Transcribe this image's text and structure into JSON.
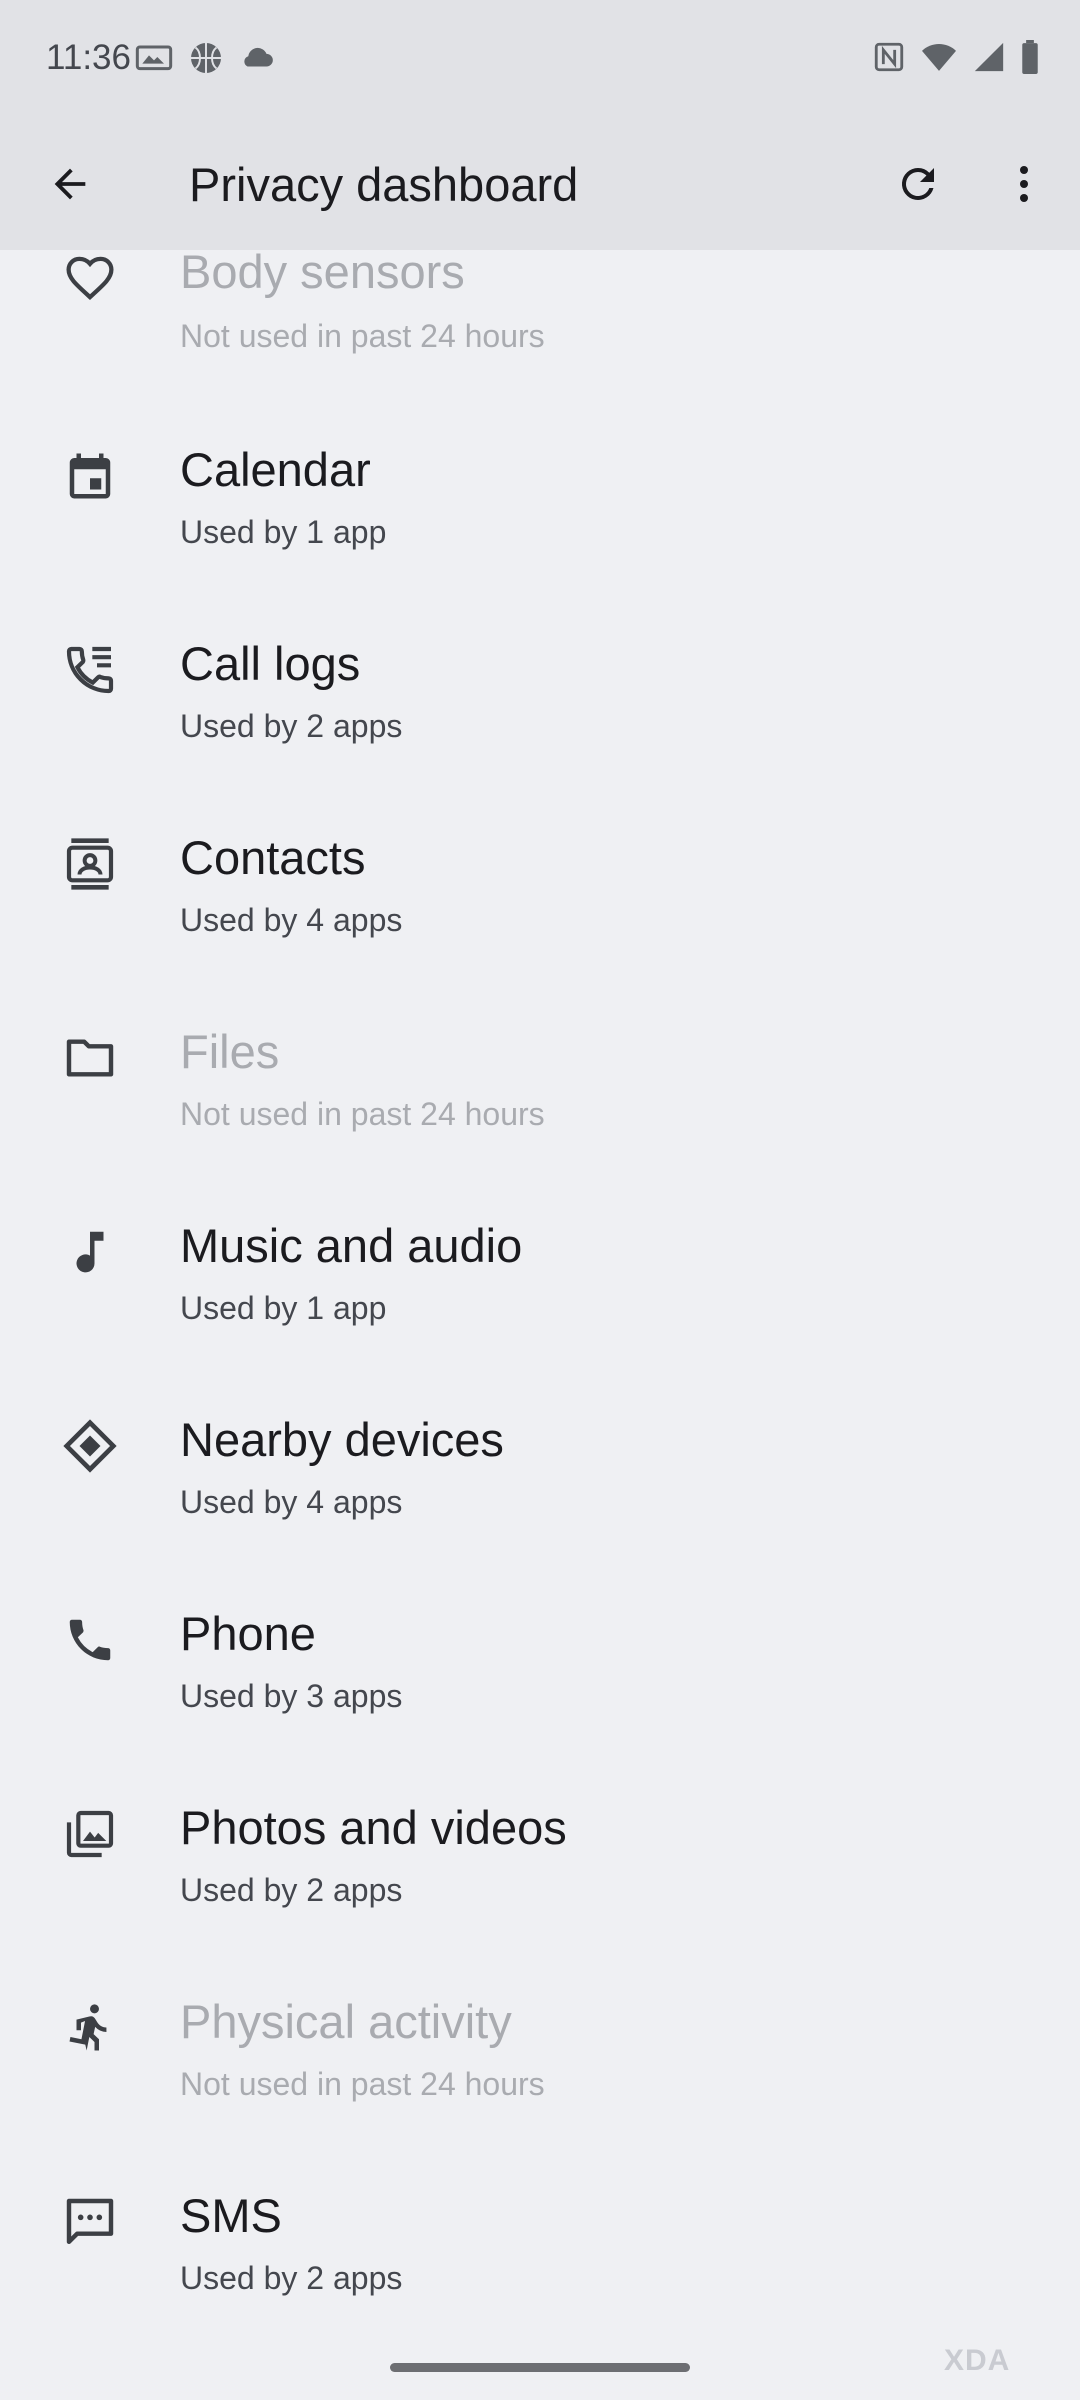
{
  "status_bar": {
    "time": "11:36",
    "left_icons": [
      "photo-icon",
      "basketball-icon",
      "cloud-icon"
    ],
    "right_icons": [
      "nfc-icon",
      "wifi-icon",
      "signal-icon",
      "battery-icon"
    ]
  },
  "app_bar": {
    "title": "Privacy dashboard",
    "back_icon": "arrow-back-icon",
    "refresh_icon": "refresh-icon",
    "more_icon": "more-vert-icon"
  },
  "permissions": [
    {
      "title": "Body sensors",
      "subtitle": "Not used in past 24 hours",
      "icon": "heart-icon",
      "disabled": true
    },
    {
      "title": "Calendar",
      "subtitle": "Used by 1 app",
      "icon": "calendar-icon",
      "disabled": false
    },
    {
      "title": "Call logs",
      "subtitle": "Used by 2 apps",
      "icon": "call-log-icon",
      "disabled": false
    },
    {
      "title": "Contacts",
      "subtitle": "Used by 4 apps",
      "icon": "contacts-icon",
      "disabled": false
    },
    {
      "title": "Files",
      "subtitle": "Not used in past 24 hours",
      "icon": "folder-icon",
      "disabled": true
    },
    {
      "title": "Music and audio",
      "subtitle": "Used by 1 app",
      "icon": "music-note-icon",
      "disabled": false
    },
    {
      "title": "Nearby devices",
      "subtitle": "Used by 4 apps",
      "icon": "nearby-icon",
      "disabled": false
    },
    {
      "title": "Phone",
      "subtitle": "Used by 3 apps",
      "icon": "phone-icon",
      "disabled": false
    },
    {
      "title": "Photos and videos",
      "subtitle": "Used by 2 apps",
      "icon": "photo-library-icon",
      "disabled": false
    },
    {
      "title": "Physical activity",
      "subtitle": "Not used in past 24 hours",
      "icon": "running-icon",
      "disabled": true
    },
    {
      "title": "SMS",
      "subtitle": "Used by 2 apps",
      "icon": "sms-icon",
      "disabled": false
    }
  ],
  "watermark": "XDA",
  "colors": {
    "background": "#eff0f3",
    "app_bar": "#e1e2e6",
    "text_primary": "#1b1b1f",
    "text_secondary": "#44474e",
    "text_disabled": "#a9abb0"
  }
}
